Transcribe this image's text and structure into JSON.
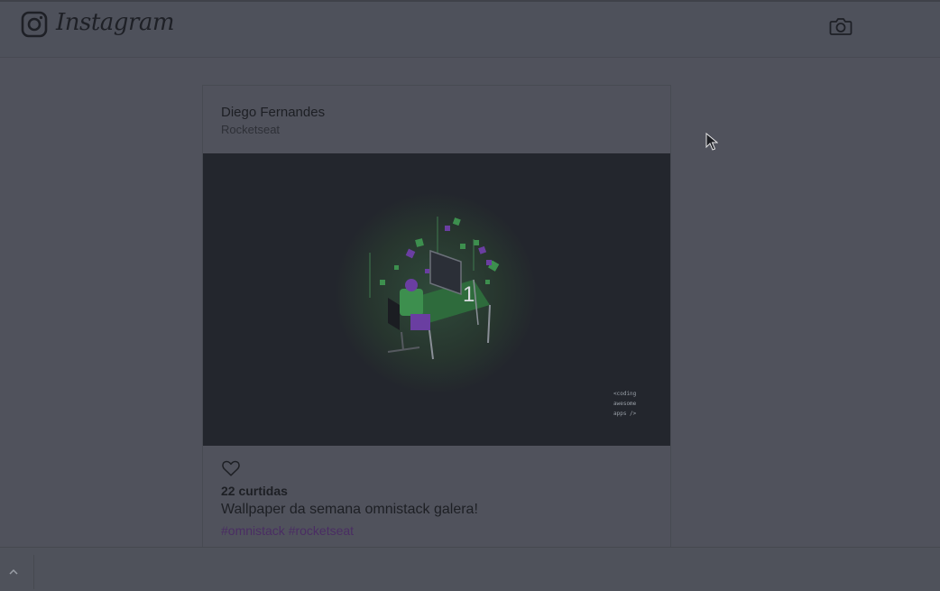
{
  "header": {
    "logo_text": "Instagram",
    "logo_icon": "instagram-icon",
    "camera_icon": "camera-icon"
  },
  "post": {
    "author": "Diego Fernandes",
    "place": "Rocketseat",
    "image": {
      "slide_number": "1",
      "tagline": "<coding\nawesome\napps />"
    },
    "like_icon": "heart-icon",
    "likes_label": "22 curtidas",
    "description": "Wallpaper da semana omnistack galera!",
    "hashtags": "#omnistack #rocketseat"
  },
  "bottom_bar": {
    "collapse_icon": "chevron-up-icon"
  },
  "colors": {
    "background": "#50525c",
    "image_background": "#23262d",
    "hashtag": "#4a2d63",
    "accent_green": "#3d8f4e",
    "accent_purple": "#6a3ea1"
  }
}
